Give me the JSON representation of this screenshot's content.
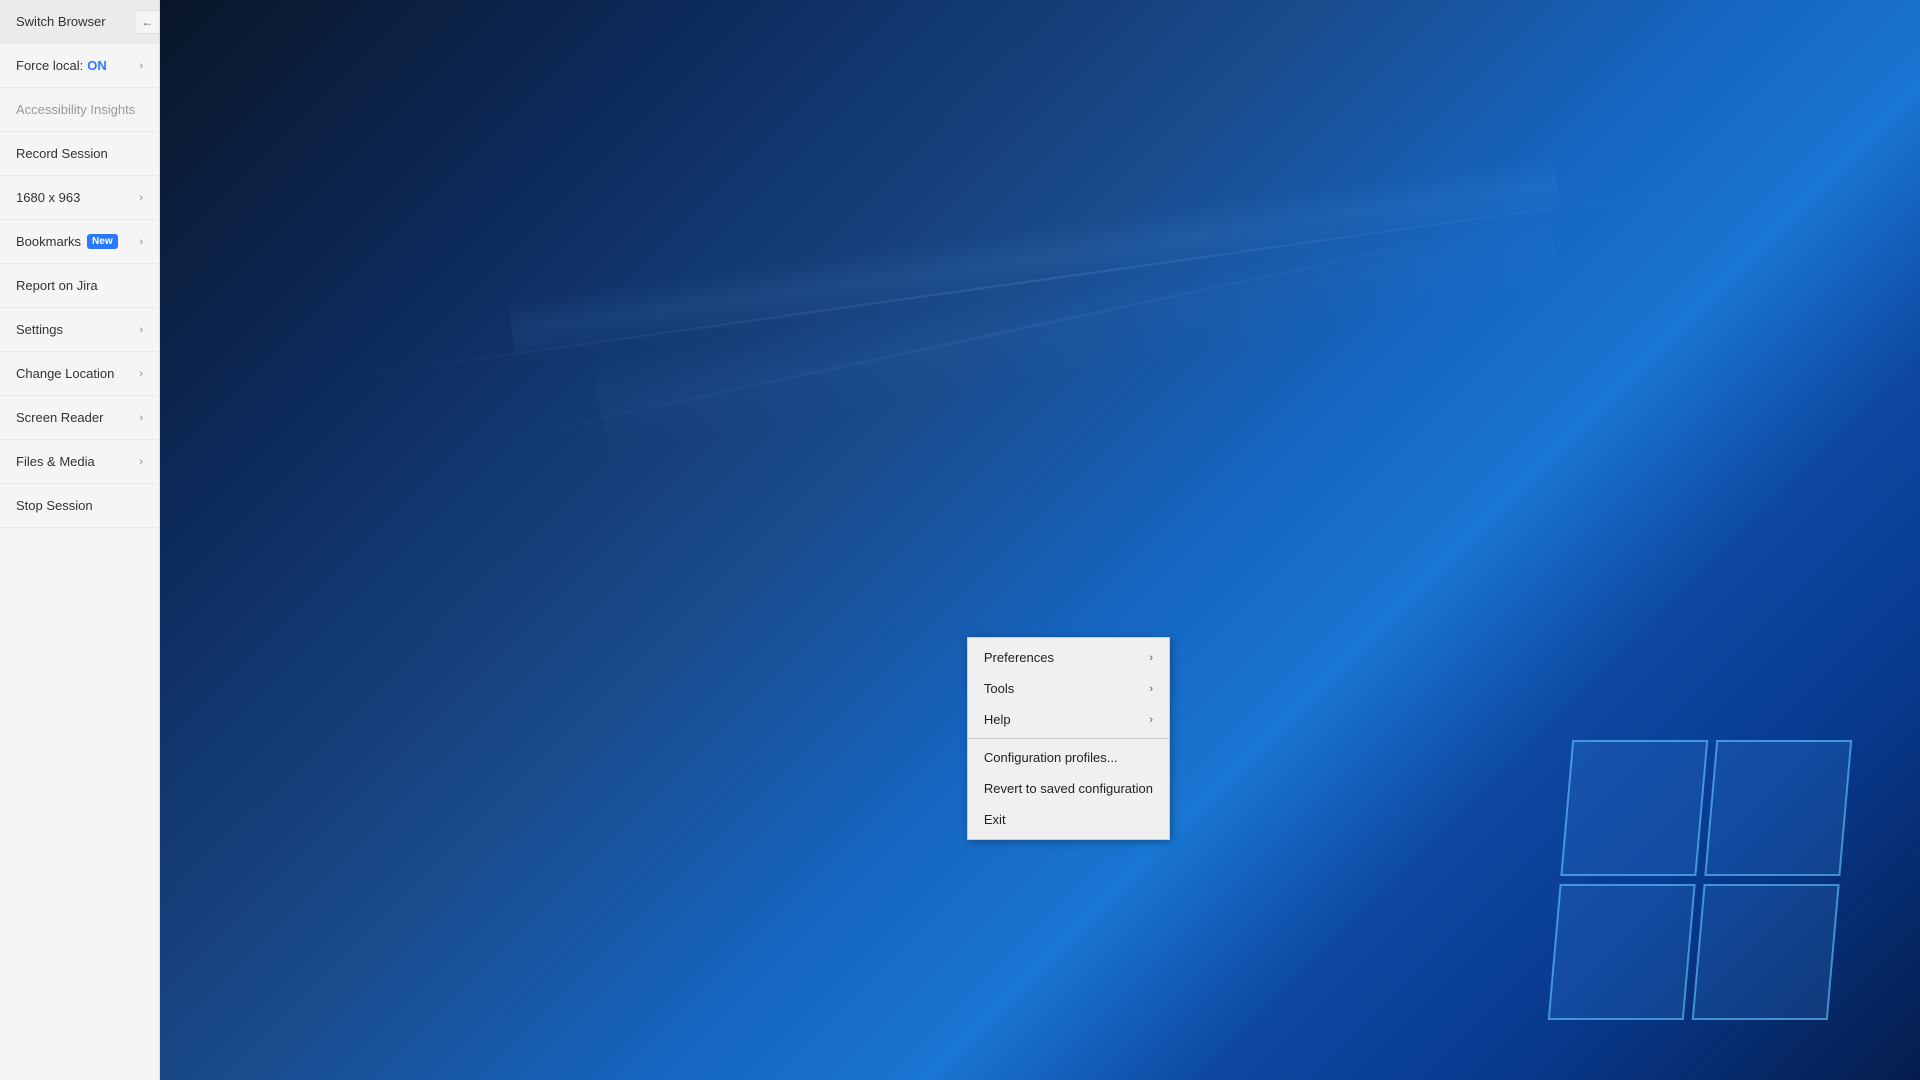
{
  "sidebar": {
    "collapse_icon": "←",
    "items": [
      {
        "id": "switch-browser",
        "label": "Switch Browser",
        "hasChevron": false,
        "disabled": false,
        "badge": null,
        "extraLabel": null
      },
      {
        "id": "force-local",
        "label": "Force local:",
        "hasChevron": true,
        "disabled": false,
        "badge": null,
        "extraLabel": "ON"
      },
      {
        "id": "accessibility-insights",
        "label": "Accessibility Insights",
        "hasChevron": false,
        "disabled": true,
        "badge": null,
        "extraLabel": null
      },
      {
        "id": "record-session",
        "label": "Record Session",
        "hasChevron": false,
        "disabled": false,
        "badge": null,
        "extraLabel": null
      },
      {
        "id": "resolution",
        "label": "1680 x 963",
        "hasChevron": true,
        "disabled": false,
        "badge": null,
        "extraLabel": null
      },
      {
        "id": "bookmarks",
        "label": "Bookmarks",
        "hasChevron": true,
        "disabled": false,
        "badge": "New",
        "extraLabel": null
      },
      {
        "id": "report-on-jira",
        "label": "Report on Jira",
        "hasChevron": false,
        "disabled": false,
        "badge": null,
        "extraLabel": null
      },
      {
        "id": "settings",
        "label": "Settings",
        "hasChevron": true,
        "disabled": false,
        "badge": null,
        "extraLabel": null
      },
      {
        "id": "change-location",
        "label": "Change Location",
        "hasChevron": true,
        "disabled": false,
        "badge": null,
        "extraLabel": null
      },
      {
        "id": "screen-reader",
        "label": "Screen Reader",
        "hasChevron": true,
        "disabled": false,
        "badge": null,
        "extraLabel": null
      },
      {
        "id": "files-and-media",
        "label": "Files & Media",
        "hasChevron": true,
        "disabled": false,
        "badge": null,
        "extraLabel": null
      },
      {
        "id": "stop-session",
        "label": "Stop Session",
        "hasChevron": false,
        "disabled": false,
        "badge": null,
        "extraLabel": null
      }
    ]
  },
  "context_menu": {
    "items": [
      {
        "id": "preferences",
        "label": "Preferences",
        "hasArrow": true
      },
      {
        "id": "tools",
        "label": "Tools",
        "hasArrow": true
      },
      {
        "id": "help",
        "label": "Help",
        "hasArrow": true
      },
      {
        "id": "separator",
        "label": null,
        "hasArrow": false
      },
      {
        "id": "configuration-profiles",
        "label": "Configuration profiles...",
        "hasArrow": false
      },
      {
        "id": "revert-saved",
        "label": "Revert to saved configuration",
        "hasArrow": false
      },
      {
        "id": "exit",
        "label": "Exit",
        "hasArrow": false
      }
    ]
  }
}
